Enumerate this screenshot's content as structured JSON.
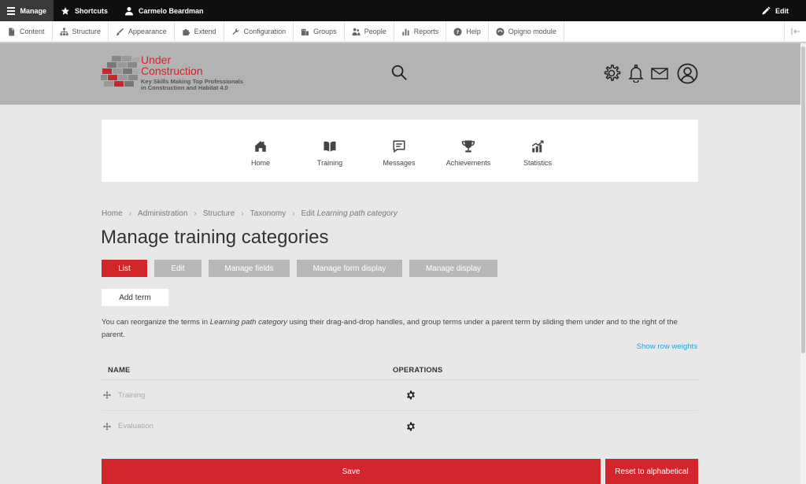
{
  "toolbar": {
    "manage_label": "Manage",
    "shortcuts_label": "Shortcuts",
    "user_label": "Carmelo Beardman",
    "edit_label": "Edit"
  },
  "admin_menu": {
    "items": [
      {
        "label": "Content",
        "icon": "file-icon"
      },
      {
        "label": "Structure",
        "icon": "sitemap-icon"
      },
      {
        "label": "Appearance",
        "icon": "brush-icon"
      },
      {
        "label": "Extend",
        "icon": "puzzle-icon"
      },
      {
        "label": "Configuration",
        "icon": "wrench-icon"
      },
      {
        "label": "Groups",
        "icon": "groups-icon"
      },
      {
        "label": "People",
        "icon": "people-icon"
      },
      {
        "label": "Reports",
        "icon": "reports-icon"
      },
      {
        "label": "Help",
        "icon": "help-icon"
      },
      {
        "label": "Opigno module",
        "icon": "opigno-icon"
      }
    ]
  },
  "logo": {
    "title_line1": "Under",
    "title_line2": "Construction",
    "subtitle_line1": "Key Skills Making Top Professionals",
    "subtitle_line2": "in Construction and Habitat 4.0"
  },
  "nav": {
    "items": [
      {
        "label": "Home",
        "icon": "home-icon"
      },
      {
        "label": "Training",
        "icon": "book-icon"
      },
      {
        "label": "Messages",
        "icon": "message-icon"
      },
      {
        "label": "Achievements",
        "icon": "trophy-icon"
      },
      {
        "label": "Statistics",
        "icon": "chart-icon"
      }
    ]
  },
  "breadcrumb": {
    "items": [
      "Home",
      "Administration",
      "Structure",
      "Taxonomy"
    ],
    "current_prefix": "Edit",
    "current_italic": "Learning path category",
    "separator": "›"
  },
  "page": {
    "title": "Manage training categories"
  },
  "tabs": [
    {
      "label": "List",
      "active": true
    },
    {
      "label": "Edit",
      "active": false
    },
    {
      "label": "Manage fields",
      "active": false
    },
    {
      "label": "Manage form display",
      "active": false
    },
    {
      "label": "Manage display",
      "active": false
    }
  ],
  "actions": {
    "add_term": "Add term",
    "show_row_weights": "Show row weights",
    "save": "Save",
    "reset": "Reset to alphabetical"
  },
  "help": {
    "before": "You can reorganize the terms in ",
    "italic": "Learning path category",
    "after": " using their drag-and-drop handles, and group terms under a parent term by sliding them under and to the right of the parent."
  },
  "table": {
    "headers": {
      "name": "NAME",
      "operations": "OPERATIONS"
    },
    "rows": [
      {
        "name": "Training"
      },
      {
        "name": "Evaluation"
      }
    ]
  },
  "colors": {
    "accent": "#d2252c",
    "link": "#2a9fd6",
    "header_bg": "#b3b3b3"
  }
}
